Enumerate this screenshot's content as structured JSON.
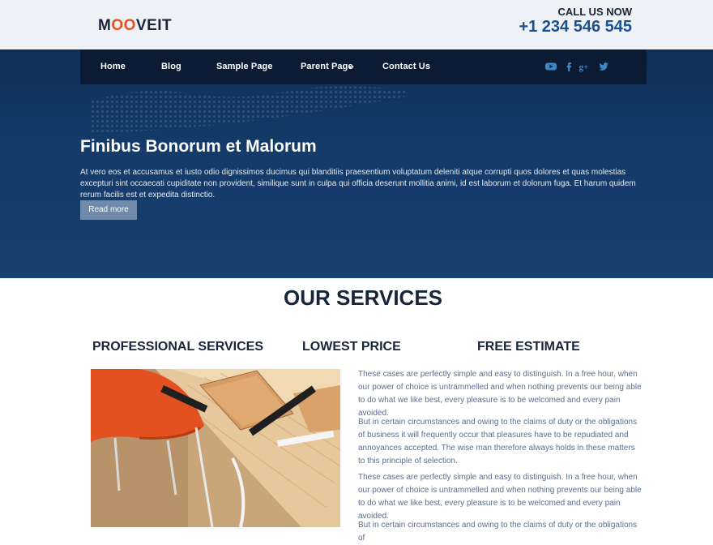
{
  "header": {
    "logo_prefix": "M",
    "logo_oo": "OO",
    "logo_suffix": "VEIT",
    "call_label": "CALL US NOW",
    "phone": "+1 234 546 545"
  },
  "nav": {
    "items": [
      "Home",
      "Blog",
      "Sample Page",
      "Parent Page",
      "Contact Us"
    ],
    "social": [
      "youtube-icon",
      "facebook-icon",
      "google-plus-icon",
      "twitter-icon"
    ]
  },
  "hero": {
    "title": "Finibus Bonorum et Malorum",
    "text": "At vero eos et accusamus et iusto odio dignissimos ducimus qui blanditiis praesentium voluptatum deleniti atque corrupti quos dolores et quas molestias excepturi sint occaecati cupiditate non provident, similique sunt in culpa qui officia deserunt mollitia animi, id est laborum et dolorum fuga. Et harum quidem rerum facilis est et expedita distinctio.",
    "button": "Read more"
  },
  "services": {
    "title": "OUR SERVICES",
    "columns": [
      "PROFESSIONAL SERVICES",
      "LOWEST PRICE",
      "FREE ESTIMATE"
    ],
    "paragraphs": [
      "These cases are perfectly simple and easy to distinguish. In a free hour, when our power of choice is untrammelled and when nothing prevents our being able to do what we like best, every pleasure is to be welcomed and every pain avoided.",
      "But in certain circumstances and owing to the claims of duty or the obligations of business it will frequently occur that pleasures have to be repudiated and annoyances accepted. The wise man therefore always holds in these matters to this principle of selection.",
      "These cases are perfectly simple and easy to distinguish. In a free hour, when our power of choice is untrammelled and when nothing prevents our being able to do what we like best, every pleasure is to be welcomed and every pain avoided.",
      "But in certain circumstances and owing to the claims of duty or the obligations of"
    ]
  },
  "colors": {
    "brand_dark": "#17253b",
    "hero_blue": "#133a68",
    "nav_bg": "#0b1b33",
    "accent_orange": "#e8501f",
    "phone_blue": "#1b4f8f",
    "social_blue": "#3d86c6",
    "button_bg": "#6f8aaa",
    "body_text": "#5b6f8e"
  }
}
